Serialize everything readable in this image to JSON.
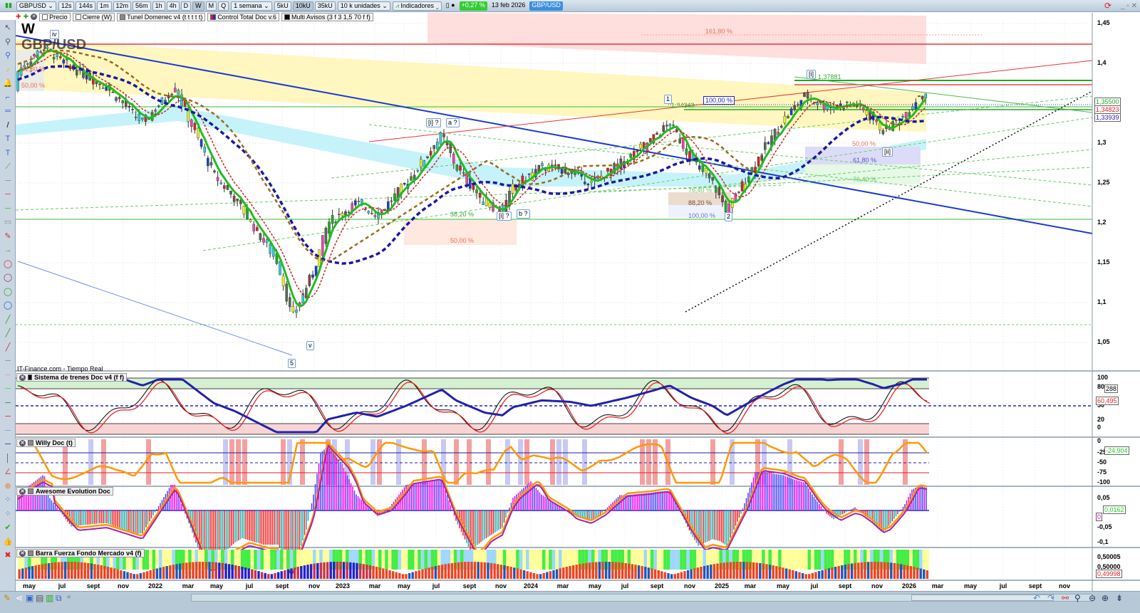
{
  "toolbar": {
    "symbol": "GBPUSD",
    "intervals": [
      "12s",
      "144s",
      "1m",
      "12m",
      "56m",
      "1h",
      "4h",
      "D",
      "W",
      "M",
      "Q"
    ],
    "active_interval": "W",
    "period": "1 semana",
    "volumes": [
      "5kU",
      "10kU",
      "35kU"
    ],
    "active_volume": "10kU",
    "units": "10 k unidades",
    "indicators": "Indicadores",
    "change": "+0,27 %",
    "date": "13 feb 2026",
    "pair": "GBP/USD"
  },
  "legend": [
    "Precio",
    "Cierre (W)",
    "Tunel Domenec v4 (t t t t t)",
    "Control Total Doc v.6",
    "Multi Avisos (3 f 3 1,5 70 f f)"
  ],
  "chart": {
    "timeframe": "W",
    "title": "GBP/USD",
    "source": "IT-Finance.com - Tiempo Real",
    "price_axis": [
      "1,45",
      "1,4",
      "1,35",
      "1,3",
      "1,25",
      "1,2",
      "1,15",
      "1,1",
      "1,05"
    ],
    "price_tags": [
      {
        "value": "1,35500",
        "color": "#22aa22"
      },
      {
        "value": "1,34823",
        "color": "#dd2222"
      },
      {
        "value": "1,33939",
        "color": "#2222bb"
      }
    ],
    "annotations": {
      "fib_1618": "161,80 %",
      "wave_iv": "iv",
      "fib_50_left": "50,00 %",
      "fib_618_left": "61,80 %",
      "wave_i_q": "[i] ?",
      "wave_a_q": "a ?",
      "fib_382": "38,20 %",
      "wave_i_q2": "[i] ?",
      "wave_b_q": "b ?",
      "fib_50_mid": "50,00 %",
      "wave_v": "v",
      "wave_5": "5",
      "wave_1": "1",
      "price_1": "1,34343",
      "fib_100_box": "100,00 %",
      "wave_i_top": "[i]",
      "price_i_top": "1,37881",
      "fib_764": "76,40 %",
      "fib_882": "88,20 %",
      "fib_100": "100,00 %",
      "wave_2": "2",
      "fib_50_right": "50,00 %",
      "wave_ii": "[ii]",
      "fib_618_right": "61,80 %",
      "fib_764_right": "76,40 %"
    }
  },
  "panels": [
    {
      "title": "Sistema de trenes Doc v4 (f f)",
      "axis": [
        "100",
        "80",
        "50",
        "20",
        "0"
      ],
      "tags": [
        "288",
        "60,495"
      ]
    },
    {
      "title": "Willy Doc (t)",
      "axis": [
        "0",
        "-25",
        "-50",
        "-75",
        "-100"
      ],
      "tags": [
        "-24,904"
      ]
    },
    {
      "title": "Awesome Evolution Doc",
      "axis": [
        "0,05",
        "-0,05",
        "-0,1"
      ],
      "tags": [
        "0,0162",
        "0"
      ]
    },
    {
      "title": "Barra Fuerza Fondo Mercado v4 (f)",
      "axis": [
        "0,50005",
        "0,50000"
      ],
      "tags": [
        "0,49998"
      ]
    }
  ],
  "time_axis": [
    "may",
    "jul",
    "sept",
    "nov",
    "2022",
    "mar",
    "may",
    "jul",
    "sept",
    "nov",
    "2023",
    "mar",
    "may",
    "jul",
    "sept",
    "nov",
    "2024",
    "mar",
    "may",
    "jul",
    "sept",
    "nov",
    "2025",
    "mar",
    "may",
    "jul",
    "sept",
    "nov",
    "2026",
    "mar",
    "may",
    "jul",
    "sept",
    "nov"
  ],
  "colors": {
    "up": "#22bb22",
    "down": "#dd2222",
    "ma_blue": "#1a1aa0",
    "trend_blue": "#1a3ad0"
  }
}
